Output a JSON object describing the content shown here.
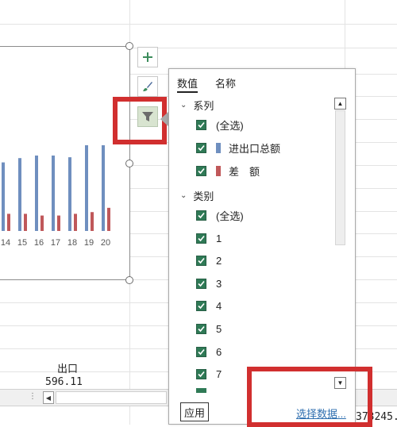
{
  "chart": {
    "x_labels": [
      "14",
      "15",
      "16",
      "17",
      "18",
      "19",
      "20"
    ]
  },
  "chart_data": {
    "type": "bar",
    "categories": [
      "14",
      "15",
      "16",
      "17",
      "18",
      "19",
      "20"
    ],
    "series": [
      {
        "name": "进出口总额",
        "values": [
          0.8,
          0.85,
          0.88,
          0.88,
          0.86,
          1.0,
          1.0
        ]
      },
      {
        "name": "差　额",
        "values": [
          0.2,
          0.2,
          0.18,
          0.18,
          0.2,
          0.22,
          0.27
        ]
      }
    ],
    "colors": {
      "进出口总额": "#6f8fbf",
      "差　额": "#c0585a"
    }
  },
  "cells": {
    "header_export": "出口",
    "value_export": "596.11",
    "value_clipped": "373245."
  },
  "panel": {
    "tabs": [
      "数值",
      "名称"
    ],
    "series_header": "系列",
    "series_items": [
      {
        "label": "(全选)",
        "checked": true
      },
      {
        "label": "进出口总额",
        "checked": true,
        "color": "#6f8fbf"
      },
      {
        "label": "差　额",
        "checked": true,
        "color": "#c0585a"
      }
    ],
    "category_header": "类别",
    "category_items": [
      {
        "label": "(全选)",
        "checked": true
      },
      {
        "label": "1",
        "checked": true
      },
      {
        "label": "2",
        "checked": true
      },
      {
        "label": "3",
        "checked": true
      },
      {
        "label": "4",
        "checked": true
      },
      {
        "label": "5",
        "checked": true
      },
      {
        "label": "6",
        "checked": true
      },
      {
        "label": "7",
        "checked": true
      }
    ],
    "apply_label": "应用",
    "select_data_label": "选择数据..."
  },
  "icons": {
    "add": "plus-icon",
    "style": "brush-icon",
    "filter": "funnel-icon"
  },
  "colors": {
    "checkbox": "#2f7a56",
    "annotation": "#d12f2f",
    "link": "#2f6fb0"
  }
}
